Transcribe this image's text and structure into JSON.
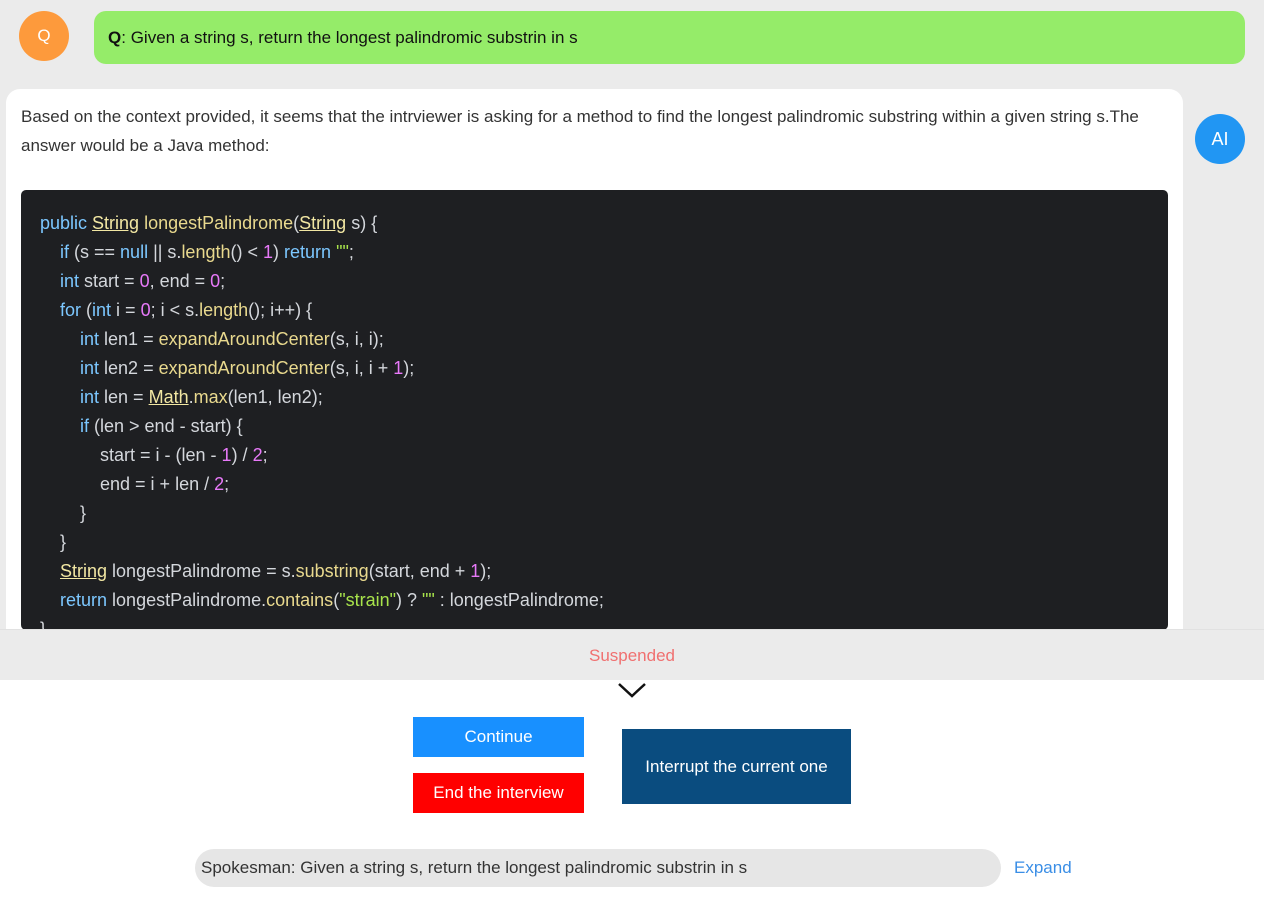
{
  "question": {
    "avatar_label": "Q",
    "prefix": "Q",
    "separator": ":",
    "text": "Given a string s, return the longest palindromic substrin in s"
  },
  "answer": {
    "avatar_label": "AI",
    "intro": "Based on the context provided, it seems that the intrviewer is asking for a method to find the longest palindromic substring within a given string s.The answer would be a Java method:",
    "code_lines": [
      [
        {
          "t": "public ",
          "c": "kw"
        },
        {
          "t": "String",
          "c": "ty"
        },
        {
          "t": " "
        },
        {
          "t": "longestPalindrome",
          "c": "fn"
        },
        {
          "t": "("
        },
        {
          "t": "String",
          "c": "ty"
        },
        {
          "t": " s) {"
        }
      ],
      [
        {
          "t": "    "
        },
        {
          "t": "if",
          "c": "kw"
        },
        {
          "t": " (s == "
        },
        {
          "t": "null",
          "c": "kw"
        },
        {
          "t": " || s."
        },
        {
          "t": "length",
          "c": "fn"
        },
        {
          "t": "() < "
        },
        {
          "t": "1",
          "c": "num"
        },
        {
          "t": ") "
        },
        {
          "t": "return",
          "c": "kw"
        },
        {
          "t": " "
        },
        {
          "t": "\"\"",
          "c": "str"
        },
        {
          "t": ";"
        }
      ],
      [
        {
          "t": "    "
        },
        {
          "t": "int",
          "c": "kw"
        },
        {
          "t": " start = "
        },
        {
          "t": "0",
          "c": "num"
        },
        {
          "t": ", end = "
        },
        {
          "t": "0",
          "c": "num"
        },
        {
          "t": ";"
        }
      ],
      [
        {
          "t": "    "
        },
        {
          "t": "for",
          "c": "kw"
        },
        {
          "t": " ("
        },
        {
          "t": "int",
          "c": "kw"
        },
        {
          "t": " i = "
        },
        {
          "t": "0",
          "c": "num"
        },
        {
          "t": "; i < s."
        },
        {
          "t": "length",
          "c": "fn"
        },
        {
          "t": "(); i++) {"
        }
      ],
      [
        {
          "t": "        "
        },
        {
          "t": "int",
          "c": "kw"
        },
        {
          "t": " len1 = "
        },
        {
          "t": "expandAroundCenter",
          "c": "fn"
        },
        {
          "t": "(s, i, i);"
        }
      ],
      [
        {
          "t": "        "
        },
        {
          "t": "int",
          "c": "kw"
        },
        {
          "t": " len2 = "
        },
        {
          "t": "expandAroundCenter",
          "c": "fn"
        },
        {
          "t": "(s, i, i + "
        },
        {
          "t": "1",
          "c": "num"
        },
        {
          "t": ");"
        }
      ],
      [
        {
          "t": "        "
        },
        {
          "t": "int",
          "c": "kw"
        },
        {
          "t": " len = "
        },
        {
          "t": "Math",
          "c": "ty"
        },
        {
          "t": "."
        },
        {
          "t": "max",
          "c": "fn"
        },
        {
          "t": "(len1, len2);"
        }
      ],
      [
        {
          "t": "        "
        },
        {
          "t": "if",
          "c": "kw"
        },
        {
          "t": " (len > end - start) {"
        }
      ],
      [
        {
          "t": "            start = i - (len - "
        },
        {
          "t": "1",
          "c": "num"
        },
        {
          "t": ") / "
        },
        {
          "t": "2",
          "c": "num"
        },
        {
          "t": ";"
        }
      ],
      [
        {
          "t": "            end = i + len / "
        },
        {
          "t": "2",
          "c": "num"
        },
        {
          "t": ";"
        }
      ],
      [
        {
          "t": "        }"
        }
      ],
      [
        {
          "t": "    }"
        }
      ],
      [
        {
          "t": "    "
        },
        {
          "t": "String",
          "c": "ty"
        },
        {
          "t": " longestPalindrome = s."
        },
        {
          "t": "substring",
          "c": "fn"
        },
        {
          "t": "(start, end + "
        },
        {
          "t": "1",
          "c": "num"
        },
        {
          "t": ");"
        }
      ],
      [
        {
          "t": "    "
        },
        {
          "t": "return",
          "c": "kw"
        },
        {
          "t": " longestPalindrome."
        },
        {
          "t": "contains",
          "c": "fn"
        },
        {
          "t": "("
        },
        {
          "t": "\"strain\"",
          "c": "str"
        },
        {
          "t": ") ? "
        },
        {
          "t": "\"\"",
          "c": "str"
        },
        {
          "t": " : longestPalindrome;"
        }
      ],
      [
        {
          "t": "}"
        }
      ]
    ]
  },
  "status": {
    "label": "Suspended",
    "icon": "chevron-down-icon"
  },
  "controls": {
    "continue_label": "Continue",
    "end_label": "End the interview",
    "interrupt_label": "Interrupt the current one"
  },
  "spokesman": {
    "text": "Spokesman: Given a string s, return the longest palindromic substrin in s",
    "expand_label": "Expand"
  },
  "colors": {
    "question_bubble": "#95ec69",
    "q_avatar": "#fd9a3c",
    "ai_avatar": "#2196f3",
    "code_bg": "#1e1f22",
    "continue": "#1890ff",
    "end": "#ff0000",
    "interrupt": "#0a4c7f",
    "status": "#f07070",
    "link": "#3a8ee6"
  }
}
